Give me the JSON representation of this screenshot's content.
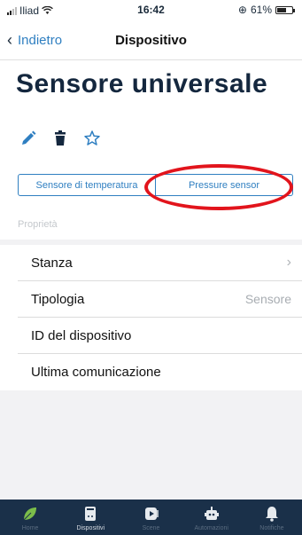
{
  "status_bar": {
    "carrier": "Iliad",
    "time": "16:42",
    "battery": "61%",
    "battery_level": 0.61
  },
  "nav": {
    "back_label": "Indietro",
    "title": "Dispositivo"
  },
  "device": {
    "title": "Sensore universale"
  },
  "actions": [
    "pencil-icon",
    "trash-icon",
    "star-icon"
  ],
  "tabs": [
    {
      "label": "Sensore di temperatura"
    },
    {
      "label": "Pressure sensor"
    }
  ],
  "section_label": "Proprietà",
  "properties": [
    {
      "label": "Stanza",
      "value": "",
      "chevron": true
    },
    {
      "label": "Tipologia",
      "value": "Sensore",
      "chevron": false
    },
    {
      "label": "ID del dispositivo",
      "value": "",
      "chevron": false
    },
    {
      "label": "Ultima comunicazione",
      "value": "",
      "chevron": false
    }
  ],
  "tab_bar": [
    {
      "label": "Home",
      "icon": "leaf-icon",
      "active": false
    },
    {
      "label": "Dispositivi",
      "icon": "device-icon",
      "active": true
    },
    {
      "label": "Scene",
      "icon": "play-icon",
      "active": false
    },
    {
      "label": "Automazioni",
      "icon": "robot-icon",
      "active": false
    },
    {
      "label": "Notifiche",
      "icon": "bell-icon",
      "active": false
    }
  ],
  "colors": {
    "accent": "#2f7fc1",
    "annotation": "#e2141c",
    "tab_bar_bg": "#1a3049",
    "leaf": "#7bbd4a"
  }
}
